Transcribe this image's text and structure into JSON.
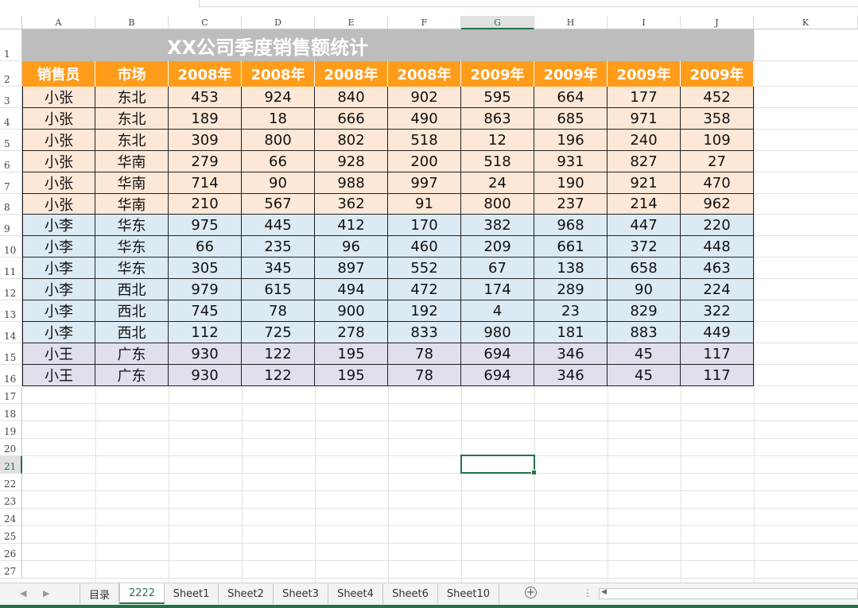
{
  "columns": [
    "A",
    "B",
    "C",
    "D",
    "E",
    "F",
    "G",
    "H",
    "I",
    "J",
    "K"
  ],
  "selected_column": "G",
  "row_numbers": [
    "1",
    "2",
    "3",
    "4",
    "5",
    "6",
    "7",
    "8",
    "9",
    "10",
    "11",
    "12",
    "13",
    "14",
    "15",
    "16",
    "17",
    "18",
    "19",
    "20",
    "21",
    "22",
    "23",
    "24",
    "25",
    "26",
    "27"
  ],
  "selected_row": "21",
  "sheet": {
    "title": "XX公司季度销售额统计",
    "headers": [
      "销售员",
      "市场",
      "2008年",
      "2008年",
      "2008年",
      "2008年",
      "2009年",
      "2009年",
      "2009年",
      "2009年"
    ],
    "rows": [
      {
        "group": "a",
        "cells": [
          "小张",
          "东北",
          "453",
          "924",
          "840",
          "902",
          "595",
          "664",
          "177",
          "452"
        ]
      },
      {
        "group": "a",
        "cells": [
          "小张",
          "东北",
          "189",
          "18",
          "666",
          "490",
          "863",
          "685",
          "971",
          "358"
        ]
      },
      {
        "group": "a",
        "cells": [
          "小张",
          "东北",
          "309",
          "800",
          "802",
          "518",
          "12",
          "196",
          "240",
          "109"
        ]
      },
      {
        "group": "a",
        "cells": [
          "小张",
          "华南",
          "279",
          "66",
          "928",
          "200",
          "518",
          "931",
          "827",
          "27"
        ]
      },
      {
        "group": "a",
        "cells": [
          "小张",
          "华南",
          "714",
          "90",
          "988",
          "997",
          "24",
          "190",
          "921",
          "470"
        ]
      },
      {
        "group": "a",
        "cells": [
          "小张",
          "华南",
          "210",
          "567",
          "362",
          "91",
          "800",
          "237",
          "214",
          "962"
        ]
      },
      {
        "group": "b",
        "cells": [
          "小李",
          "华东",
          "975",
          "445",
          "412",
          "170",
          "382",
          "968",
          "447",
          "220"
        ]
      },
      {
        "group": "b",
        "cells": [
          "小李",
          "华东",
          "66",
          "235",
          "96",
          "460",
          "209",
          "661",
          "372",
          "448"
        ]
      },
      {
        "group": "b",
        "cells": [
          "小李",
          "华东",
          "305",
          "345",
          "897",
          "552",
          "67",
          "138",
          "658",
          "463"
        ]
      },
      {
        "group": "b",
        "cells": [
          "小李",
          "西北",
          "979",
          "615",
          "494",
          "472",
          "174",
          "289",
          "90",
          "224"
        ]
      },
      {
        "group": "b",
        "cells": [
          "小李",
          "西北",
          "745",
          "78",
          "900",
          "192",
          "4",
          "23",
          "829",
          "322"
        ]
      },
      {
        "group": "b",
        "cells": [
          "小李",
          "西北",
          "112",
          "725",
          "278",
          "833",
          "980",
          "181",
          "883",
          "449"
        ]
      },
      {
        "group": "c",
        "cells": [
          "小王",
          "广东",
          "930",
          "122",
          "195",
          "78",
          "694",
          "346",
          "45",
          "117"
        ]
      },
      {
        "group": "c",
        "cells": [
          "小王",
          "广东",
          "930",
          "122",
          "195",
          "78",
          "694",
          "346",
          "45",
          "117"
        ]
      }
    ]
  },
  "tabs": [
    {
      "label": "目录",
      "active": false
    },
    {
      "label": "2222",
      "active": true
    },
    {
      "label": "Sheet1",
      "active": false
    },
    {
      "label": "Sheet2",
      "active": false
    },
    {
      "label": "Sheet3",
      "active": false
    },
    {
      "label": "Sheet4",
      "active": false
    },
    {
      "label": "Sheet6",
      "active": false
    },
    {
      "label": "Sheet10",
      "active": false
    }
  ],
  "colors": {
    "title_bg": "#bdbdbd",
    "header_bg": "#ff9c1a",
    "group_a": "#fde8d8",
    "group_b": "#dcebf3",
    "group_c": "#e2dfed",
    "accent": "#217346"
  },
  "icons": {
    "prev": "triangle-left-icon",
    "next": "triangle-right-icon",
    "add": "plus-circle-icon",
    "more": "vertical-dots-icon",
    "scroll_left": "scroll-left-icon"
  }
}
